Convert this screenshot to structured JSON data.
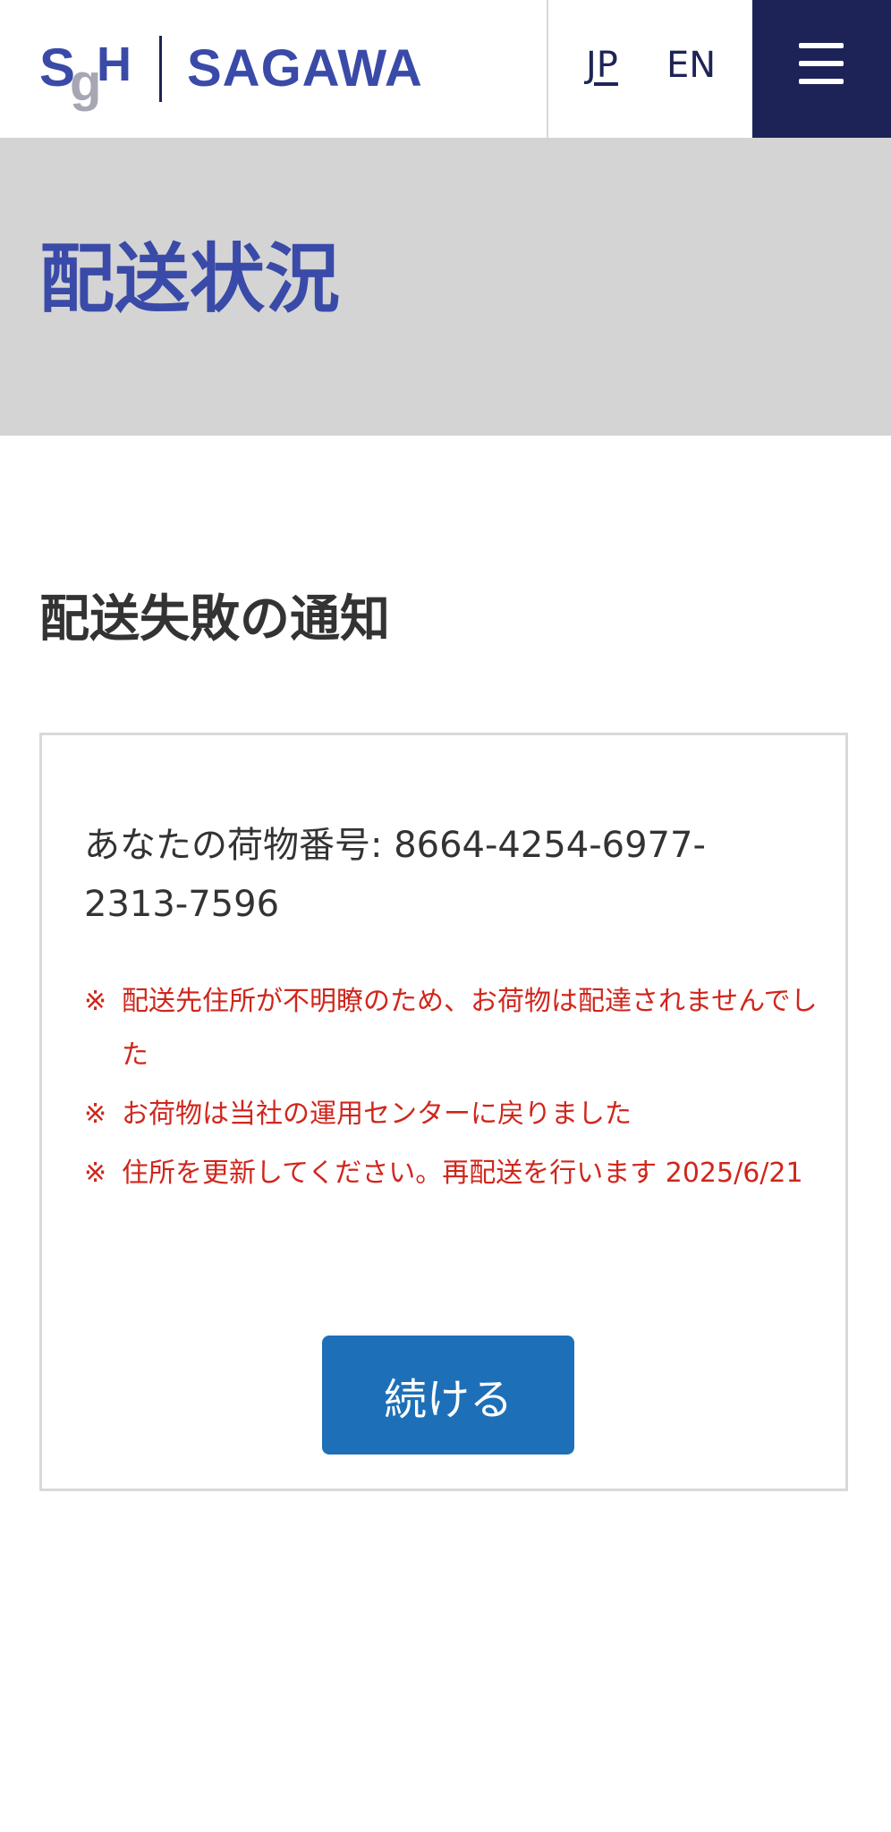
{
  "header": {
    "logo": {
      "sgh_s": "S",
      "sgh_g": "g",
      "sgh_h": "H",
      "wordmark": "SAGAWA"
    },
    "languages": [
      {
        "label": "JP",
        "active": true
      },
      {
        "label": "EN",
        "active": false
      }
    ],
    "menu_icon": "hamburger-menu-icon"
  },
  "hero": {
    "title": "配送状況"
  },
  "main": {
    "section_title": "配送失敗の通知",
    "card": {
      "tracking_line": "あなたの荷物番号: 8664-4254-6977-2313-7596",
      "notice_mark": "※",
      "notices": [
        "配送先住所が不明瞭のため、お荷物は配達されませんでした",
        "お荷物は当社の運用センターに戻りました",
        "住所を更新してください。再配送を行います 2025/6/21"
      ],
      "button_label": "続ける"
    }
  },
  "colors": {
    "brand_blue": "#3a4aa8",
    "navy": "#1d2357",
    "hero_bg": "#d4d4d4",
    "alert_red": "#d0261c",
    "button_blue": "#1d70b8"
  }
}
